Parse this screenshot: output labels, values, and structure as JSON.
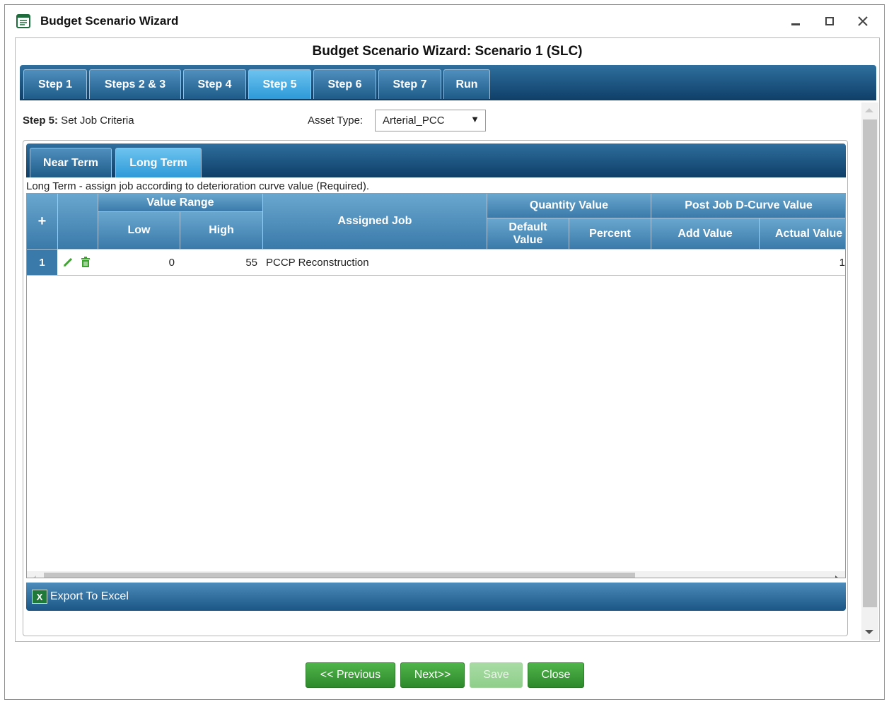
{
  "window": {
    "title": "Budget Scenario Wizard",
    "controls": [
      "minimize-icon",
      "maximize-icon",
      "close-icon"
    ]
  },
  "wizard": {
    "heading": "Budget Scenario Wizard: Scenario 1 (SLC)",
    "steps": [
      "Step 1",
      "Steps 2 & 3",
      "Step 4",
      "Step 5",
      "Step 6",
      "Step 7",
      "Run"
    ],
    "active_step": "Step 5"
  },
  "step5": {
    "label_bold": "Step 5:",
    "label_text": " Set Job Criteria",
    "asset_type_label": "Asset Type:",
    "asset_type_value": "Arterial_PCC"
  },
  "terms": {
    "tabs": [
      "Near Term",
      "Long Term"
    ],
    "active": "Long Term",
    "description": "Long Term - assign job according to deterioration curve value (Required)."
  },
  "grid": {
    "headers": {
      "add": "+",
      "value_range": "Value Range",
      "low": "Low",
      "high": "High",
      "assigned_job": "Assigned Job",
      "quantity_value": "Quantity Value",
      "default_value": "Default Value",
      "percent": "Percent",
      "post_job": "Post Job D-Curve Value",
      "add_value": "Add Value",
      "actual_value": "Actual Value"
    },
    "rows": [
      {
        "num": "1",
        "low": "0",
        "high": "55",
        "assigned_job": "PCCP Reconstruction",
        "default_value": "",
        "percent": "",
        "add_value": "",
        "actual_value": "1"
      }
    ],
    "row_actions": [
      "edit-icon",
      "delete-icon"
    ]
  },
  "export": {
    "label": "Export To Excel"
  },
  "footer": {
    "previous": "<< Previous",
    "next": "Next>>",
    "save": "Save",
    "close": "Close"
  },
  "colors": {
    "header_blue": "#2f6f9e",
    "active_tab": "#2d9ad8",
    "button_green": "#3a9b36"
  }
}
